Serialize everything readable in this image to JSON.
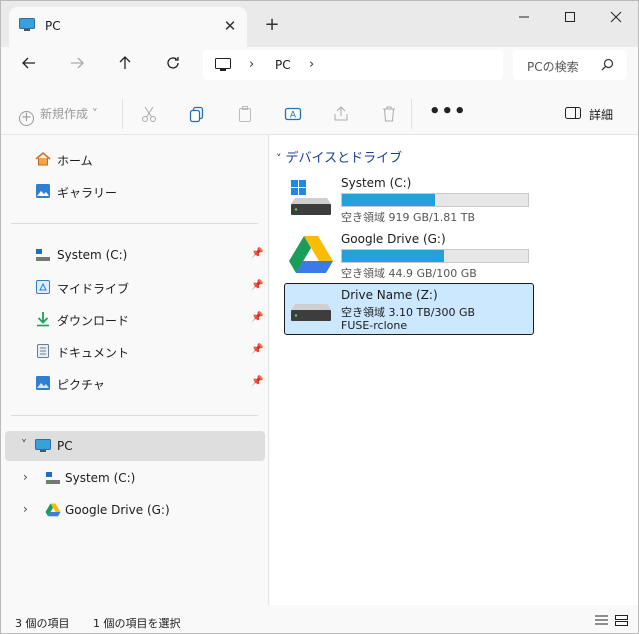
{
  "window": {
    "tab_title": "PC",
    "tab_close": "✕",
    "new_tab": "+"
  },
  "nav": {
    "address_text": "PC",
    "search_placeholder": "PCの検索"
  },
  "toolbar": {
    "new_label": "新規作成",
    "more": "•••",
    "details_label": "詳細"
  },
  "sidebar": {
    "top_items": [
      {
        "label": "ホーム",
        "icon": "home-icon"
      },
      {
        "label": "ギャラリー",
        "icon": "gallery-icon"
      }
    ],
    "quick_items": [
      {
        "label": "System (C:)",
        "icon": "drive-icon"
      },
      {
        "label": "マイドライブ",
        "icon": "mydrive-icon"
      },
      {
        "label": "ダウンロード",
        "icon": "download-icon"
      },
      {
        "label": "ドキュメント",
        "icon": "document-icon"
      },
      {
        "label": "ピクチャ",
        "icon": "picture-icon"
      }
    ],
    "tree": {
      "pc_label": "PC",
      "children": [
        {
          "label": "System (C:)",
          "icon": "drive-icon"
        },
        {
          "label": "Google Drive (G:)",
          "icon": "google-drive-icon"
        }
      ]
    }
  },
  "content": {
    "group_title": "デバイスとドライブ",
    "drives": [
      {
        "name": "System (C:)",
        "free_text": "空き領域 919 GB/1.81 TB",
        "used_fraction": 0.5,
        "icon": "windows-drive-icon"
      },
      {
        "name": "Google Drive (G:)",
        "free_text": "空き領域 44.9 GB/100 GB",
        "used_fraction": 0.55,
        "icon": "google-drive-icon"
      },
      {
        "name": "Drive Name (Z:)",
        "free_text": "空き領域 3.10 TB/300 GB",
        "fs_text": "FUSE-rclone",
        "icon": "drive-icon"
      }
    ]
  },
  "status": {
    "items": "3 個の項目",
    "selected": "1 個の項目を選択"
  },
  "colors": {
    "accent": "#26a0da",
    "selection": "#cce8ff"
  }
}
